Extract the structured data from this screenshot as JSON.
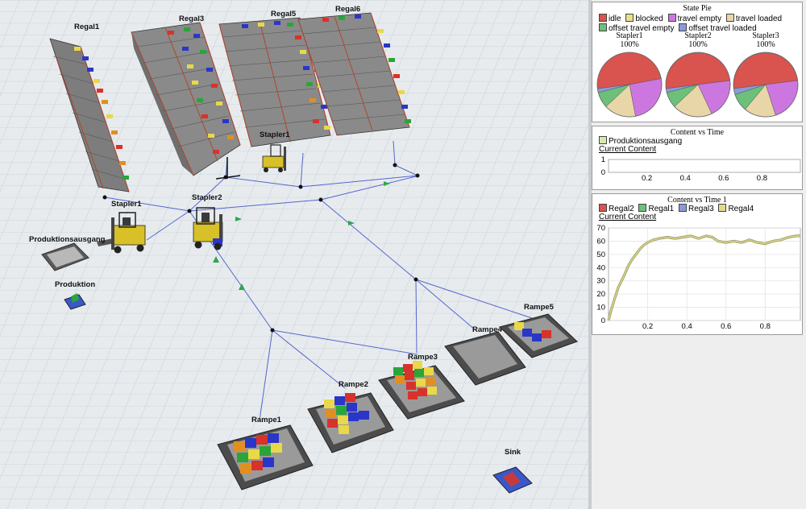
{
  "scene": {
    "labels": {
      "regal1": "Regal1",
      "regal3": "Regal3",
      "regal5": "Regal5",
      "regal6": "Regal6",
      "stapler1_top": "Stapler1",
      "stapler1": "Stapler1",
      "stapler2": "Stapler2",
      "produktionsausgang": "Produktionsausgang",
      "produktion": "Produktion",
      "rampe1": "Rampe1",
      "rampe2": "Rampe2",
      "rampe3": "Rampe3",
      "rampe4": "Rampe4",
      "rampe5": "Rampe5",
      "sink": "Sink"
    }
  },
  "dashboard": {
    "state_pie": {
      "title": "State Pie",
      "legend": [
        {
          "label": "idle",
          "color": "#d9534f"
        },
        {
          "label": "blocked",
          "color": "#e8e28a"
        },
        {
          "label": "travel empty",
          "color": "#cc77e0"
        },
        {
          "label": "travel loaded",
          "color": "#e8d6a8"
        },
        {
          "label": "offset travel empty",
          "color": "#6cc07a"
        },
        {
          "label": "offset travel loaded",
          "color": "#8a9ad8"
        }
      ],
      "pies": [
        {
          "name": "Stapler1",
          "pct": "100%"
        },
        {
          "name": "Stapler2",
          "pct": "100%"
        },
        {
          "name": "Stapler3",
          "pct": "100%"
        }
      ]
    },
    "content_time": {
      "title": "Content vs Time",
      "legend": [
        {
          "label": "Produktionsausgang",
          "color": "#d8e8b0"
        }
      ],
      "subtitle": "Current Content"
    },
    "content_time1": {
      "title": "Content vs Time 1",
      "legend": [
        {
          "label": "Regal2",
          "color": "#d9534f"
        },
        {
          "label": "Regal1",
          "color": "#6cc07a"
        },
        {
          "label": "Regal3",
          "color": "#8a9ad8"
        },
        {
          "label": "Regal4",
          "color": "#e0dc8a"
        }
      ],
      "subtitle": "Current Content"
    }
  },
  "chart_data": [
    {
      "type": "pie",
      "title": "State Pie",
      "categories": [
        "idle",
        "blocked",
        "travel empty",
        "travel loaded",
        "offset travel empty",
        "offset travel loaded"
      ],
      "series": [
        {
          "name": "Stapler1",
          "values": [
            49,
            0,
            25,
            16,
            8,
            2
          ]
        },
        {
          "name": "Stapler2",
          "values": [
            50,
            0,
            20,
            20,
            8,
            2
          ]
        },
        {
          "name": "Stapler3",
          "values": [
            50,
            0,
            22,
            16,
            9,
            3
          ]
        }
      ]
    },
    {
      "type": "line",
      "title": "Content vs Time",
      "xlabel": "",
      "ylabel": "",
      "xticks": [
        0.2,
        0.4,
        0.6,
        0.8
      ],
      "yticks": [
        0,
        1
      ],
      "xlim": [
        0,
        1
      ],
      "ylim": [
        0,
        1
      ],
      "series": [
        {
          "name": "Produktionsausgang",
          "x": [],
          "y": []
        }
      ]
    },
    {
      "type": "line",
      "title": "Content vs Time 1",
      "xlabel": "",
      "ylabel": "",
      "xticks": [
        0.2,
        0.4,
        0.6,
        0.8
      ],
      "yticks": [
        0,
        10,
        20,
        30,
        40,
        50,
        60,
        70
      ],
      "xlim": [
        0,
        0.98
      ],
      "ylim": [
        0,
        70
      ],
      "series": [
        {
          "name": "Regal4",
          "x": [
            0,
            0.01,
            0.03,
            0.05,
            0.08,
            0.1,
            0.12,
            0.14,
            0.16,
            0.18,
            0.2,
            0.23,
            0.26,
            0.3,
            0.34,
            0.38,
            0.42,
            0.46,
            0.5,
            0.53,
            0.56,
            0.6,
            0.64,
            0.68,
            0.72,
            0.76,
            0.8,
            0.84,
            0.88,
            0.92,
            0.96,
            0.98
          ],
          "y": [
            0,
            6,
            16,
            25,
            34,
            41,
            46,
            50,
            54,
            57,
            59,
            61,
            62,
            63,
            62,
            63,
            64,
            62,
            64,
            63,
            60,
            59,
            60,
            59,
            61,
            59,
            58,
            60,
            61,
            63,
            64,
            64
          ]
        }
      ]
    }
  ]
}
